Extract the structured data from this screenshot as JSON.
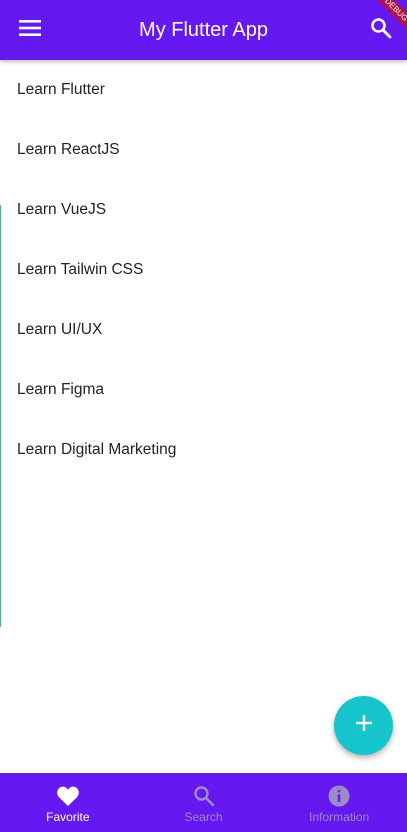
{
  "app_bar": {
    "title": "My Flutter App",
    "menu_icon": "hamburger-menu-icon",
    "search_icon": "search-icon",
    "background_color": "#6518f0",
    "debug_banner": "DEBUG"
  },
  "list": {
    "items": [
      {
        "label": "Learn Flutter"
      },
      {
        "label": "Learn ReactJS"
      },
      {
        "label": "Learn VueJS"
      },
      {
        "label": "Learn Tailwin CSS"
      },
      {
        "label": "Learn UI/UX"
      },
      {
        "label": "Learn Figma"
      },
      {
        "label": "Learn Digital Marketing"
      }
    ]
  },
  "fab": {
    "icon": "plus-icon",
    "color": "#16c5cc"
  },
  "bottom_nav": {
    "background_color": "#6518f0",
    "items": [
      {
        "label": "Favorite",
        "icon": "heart-icon",
        "active": true
      },
      {
        "label": "Search",
        "icon": "search-icon",
        "active": false
      },
      {
        "label": "Information",
        "icon": "info-icon",
        "active": false
      }
    ]
  }
}
